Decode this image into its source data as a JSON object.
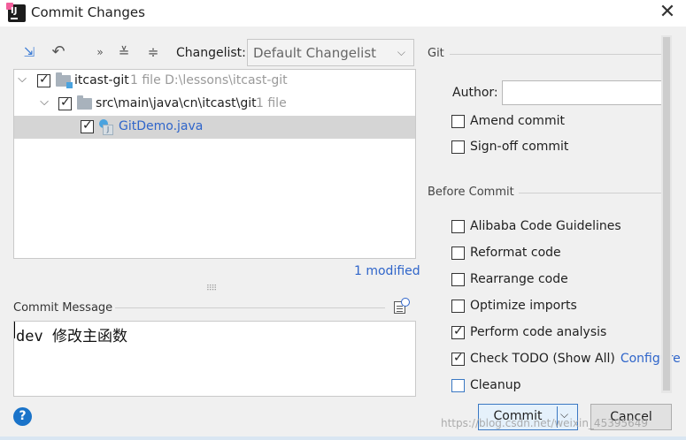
{
  "window": {
    "title": "Commit Changes"
  },
  "toolbar": {
    "changelist_label": "Changelist:",
    "changelist_value": "Default Changelist"
  },
  "tree": {
    "rows": [
      {
        "name": "itcast-git",
        "meta": "1 file  D:\\lessons\\itcast-git"
      },
      {
        "name": "src\\main\\java\\cn\\itcast\\git",
        "meta": "1 file"
      },
      {
        "name": "GitDemo.java"
      }
    ],
    "status": "1 modified"
  },
  "commit_message": {
    "label": "Commit Message",
    "text": "dev 修改主函数"
  },
  "git": {
    "section": "Git",
    "author_label": "Author:",
    "author_value": "",
    "options": [
      {
        "label": "Amend commit",
        "checked": false
      },
      {
        "label": "Sign-off commit",
        "checked": false
      }
    ]
  },
  "before_commit": {
    "section": "Before Commit",
    "options": [
      {
        "label": "Alibaba Code Guidelines",
        "checked": false
      },
      {
        "label": "Reformat code",
        "checked": false
      },
      {
        "label": "Rearrange code",
        "checked": false
      },
      {
        "label": "Optimize imports",
        "checked": false
      },
      {
        "label": "Perform code analysis",
        "checked": true
      },
      {
        "label": "Check TODO (Show All)",
        "checked": true,
        "link": "Configure"
      },
      {
        "label": "Cleanup",
        "checked": false
      }
    ]
  },
  "footer": {
    "help": "?",
    "commit_label": "Commit",
    "cancel_label": "Cancel",
    "watermark": "https://blog.csdn.net/weixin_45395649"
  },
  "colors": {
    "accent": "#2f65ca",
    "selection": "#d5d5d5",
    "help": "#1a73c9"
  }
}
